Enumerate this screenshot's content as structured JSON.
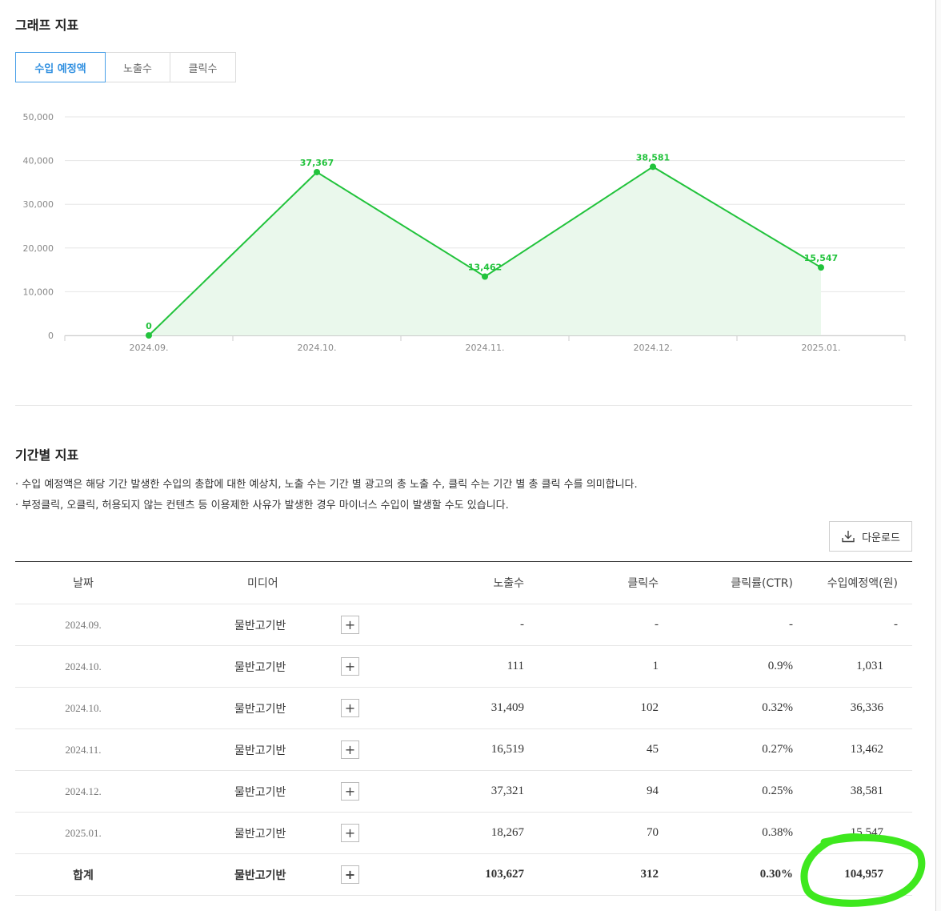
{
  "graph_section": {
    "title": "그래프 지표"
  },
  "tabs": [
    {
      "label": "수입 예정액",
      "active": true
    },
    {
      "label": "노출수",
      "active": false
    },
    {
      "label": "클릭수",
      "active": false
    }
  ],
  "chart_data": {
    "type": "area",
    "categories": [
      "2024.09.",
      "2024.10.",
      "2024.11.",
      "2024.12.",
      "2025.01."
    ],
    "values": [
      0,
      37367,
      13462,
      38581,
      15547
    ],
    "data_labels": [
      "0",
      "37,367",
      "13,462",
      "38,581",
      "15,547"
    ],
    "y_ticks": [
      "0",
      "10,000",
      "20,000",
      "30,000",
      "40,000",
      "50,000"
    ],
    "ylim": [
      0,
      50000
    ],
    "line_color": "#22c33c",
    "fill_color": "#eaf8ec",
    "grid": true,
    "legend": "none"
  },
  "period_section": {
    "title": "기간별 지표",
    "notes": [
      "·  수입 예정액은 해당 기간 발생한 수입의 총합에 대한 예상치, 노출 수는 기간 별 광고의 총 노출 수, 클릭 수는 기간 별 총 클릭 수를 의미합니다.",
      "·  부정클릭, 오클릭, 허용되지 않는 컨텐츠 등 이용제한 사유가 발생한 경우 마이너스 수입이 발생할 수도 있습니다."
    ],
    "download_label": "다운로드"
  },
  "table": {
    "headers": [
      "날짜",
      "미디어",
      "노출수",
      "클릭수",
      "클릭률(CTR)",
      "수입예정액(원)"
    ],
    "rows": [
      {
        "date": "2024.09.",
        "media": "물반고기반",
        "impressions": "-",
        "clicks": "-",
        "ctr": "-",
        "revenue": "-"
      },
      {
        "date": "2024.10.",
        "media": "물반고기반",
        "impressions": "111",
        "clicks": "1",
        "ctr": "0.9%",
        "revenue": "1,031"
      },
      {
        "date": "2024.10.",
        "media": "물반고기반",
        "impressions": "31,409",
        "clicks": "102",
        "ctr": "0.32%",
        "revenue": "36,336"
      },
      {
        "date": "2024.11.",
        "media": "물반고기반",
        "impressions": "16,519",
        "clicks": "45",
        "ctr": "0.27%",
        "revenue": "13,462"
      },
      {
        "date": "2024.12.",
        "media": "물반고기반",
        "impressions": "37,321",
        "clicks": "94",
        "ctr": "0.25%",
        "revenue": "38,581"
      },
      {
        "date": "2025.01.",
        "media": "물반고기반",
        "impressions": "18,267",
        "clicks": "70",
        "ctr": "0.38%",
        "revenue": "15,547"
      }
    ],
    "total": {
      "label": "합계",
      "media": "물반고기반",
      "impressions": "103,627",
      "clicks": "312",
      "ctr": "0.30%",
      "revenue": "104,957"
    }
  },
  "highlight_color": "#3ee81e"
}
